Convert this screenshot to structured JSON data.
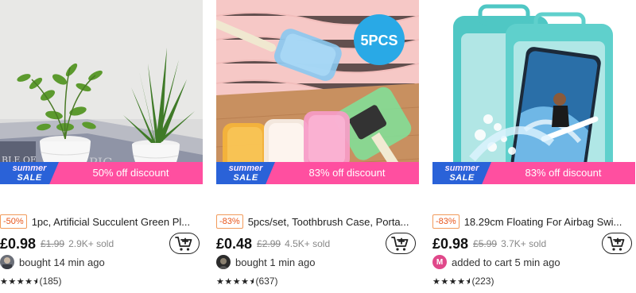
{
  "products": [
    {
      "image_alt": "",
      "banner": {
        "summer": "summer",
        "sale": "SALE",
        "discount_text": "50% off discount"
      },
      "discount_badge": "-50%",
      "title": "1pc, Artificial Succulent Green Pl...",
      "price": "£0.98",
      "old_price": "£1.99",
      "sold": "2.9K+ sold",
      "activity": "bought 14 min ago",
      "rating": 4.5,
      "review_count": "(185)"
    },
    {
      "image_alt": "",
      "image_badge": "5PCS",
      "banner": {
        "summer": "summer",
        "sale": "SALE",
        "discount_text": "83% off discount"
      },
      "discount_badge": "-83%",
      "title": "5pcs/set, Toothbrush Case, Porta...",
      "price": "£0.48",
      "old_price": "£2.99",
      "sold": "4.5K+ sold",
      "activity": "bought 1 min ago",
      "rating": 4.5,
      "review_count": "(637)"
    },
    {
      "image_alt": "",
      "banner": {
        "summer": "summer",
        "sale": "SALE",
        "discount_text": "83% off discount"
      },
      "discount_badge": "-83%",
      "title": "18.29cm Floating For Airbag Swi...",
      "price": "£0.98",
      "old_price": "£5.99",
      "sold": "3.7K+ sold",
      "activity": "added to cart 5 min ago",
      "avatar_letter": "M",
      "rating": 4.5,
      "review_count": "(223)"
    }
  ],
  "icons": {
    "cart": "add-to-cart-icon"
  },
  "colors": {
    "banner_pink": "#ff4fa0",
    "summer_blue": "#2a62d8",
    "badge_orange": "#e8561b"
  }
}
